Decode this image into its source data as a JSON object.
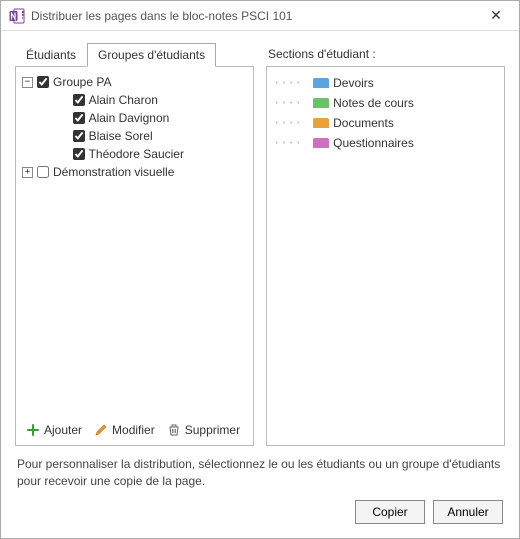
{
  "window": {
    "title": "Distribuer les pages dans le bloc-notes PSCI 101",
    "close_label": "✕"
  },
  "tabs": {
    "students": "Étudiants",
    "groups": "Groupes d'étudiants"
  },
  "tree": {
    "group1": {
      "expander": "−",
      "name": "Groupe PA",
      "checked": true,
      "students": [
        {
          "name": "Alain Charon",
          "checked": true
        },
        {
          "name": "Alain Davignon",
          "checked": true
        },
        {
          "name": "Blaise Sorel",
          "checked": true
        },
        {
          "name": "Théodore Saucier",
          "checked": true
        }
      ]
    },
    "group2": {
      "expander": "+",
      "name": "Démonstration visuelle",
      "checked": false
    }
  },
  "sections": {
    "heading": "Sections d'étudiant :",
    "items": [
      {
        "label": "Devoirs",
        "color": "#5aa5e0"
      },
      {
        "label": "Notes de cours",
        "color": "#6cc168"
      },
      {
        "label": "Documents",
        "color": "#e9a23b"
      },
      {
        "label": "Questionnaires",
        "color": "#cf6fc1"
      }
    ]
  },
  "toolbar": {
    "add": "Ajouter",
    "edit": "Modifier",
    "delete": "Supprimer"
  },
  "footer": {
    "help": "Pour personnaliser la distribution, sélectionnez le ou les étudiants ou un groupe d'étudiants pour recevoir une copie de la page.",
    "copy": "Copier",
    "cancel": "Annuler"
  }
}
